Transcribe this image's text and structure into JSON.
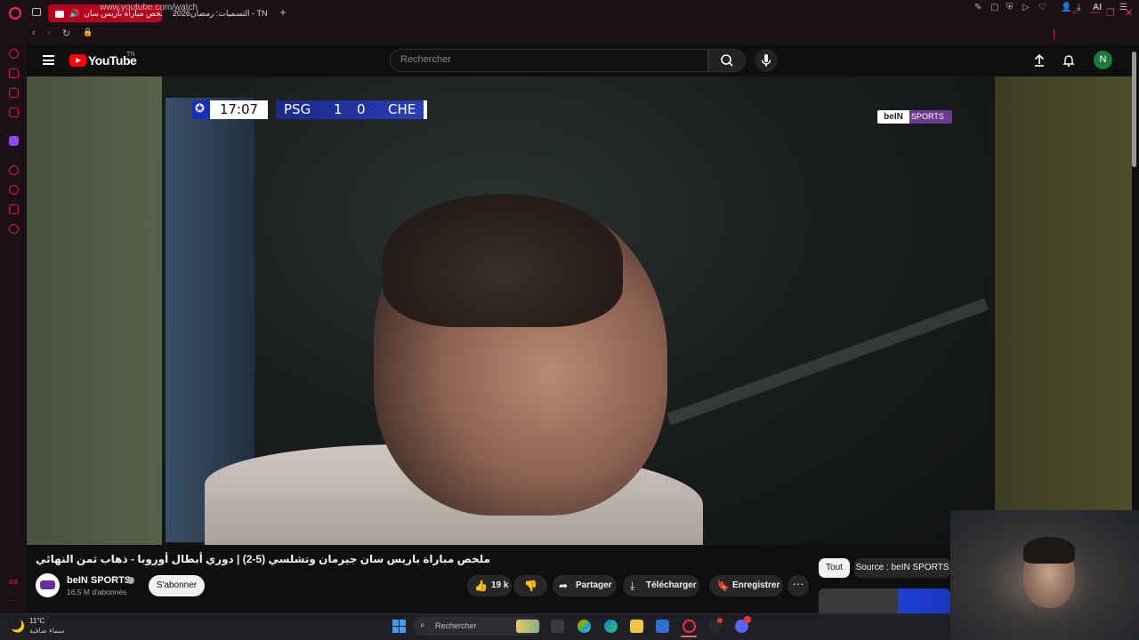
{
  "browser": {
    "tabs": [
      {
        "label": "ملخص مباراة باريس سان",
        "active": true
      },
      {
        "label": "التسميات: رمضان2026 - TN",
        "active": false
      }
    ],
    "url": "www.youtube.com/watch",
    "ai_label": "AI"
  },
  "youtube": {
    "logo_text": "YouTube",
    "country_code": "TN",
    "search_placeholder": "Rechercher",
    "avatar_letter": "N"
  },
  "video": {
    "scoreboard": {
      "time": "17:07",
      "home": "PSG",
      "home_score": "1",
      "away_score": "0",
      "away": "CHE"
    },
    "broadcaster_logo": {
      "part1": "beIN",
      "part2": "SPORTS"
    },
    "title": "ملخص مباراة باريس سان جيرمان وتشلسي (5-2) | دوري أبطال أوروبا - ذهاب ثمن النهائي",
    "channel": {
      "name": "beIN SPORTS",
      "subscribers": "16,5 M d'abonnés"
    },
    "subscribe_label": "S'abonner",
    "likes": "19 k",
    "actions": {
      "share": "Partager",
      "download": "Télécharger",
      "save": "Enregistrer"
    }
  },
  "filter_chips": [
    "Tout",
    "Source : beIN SPORTS"
  ],
  "taskbar": {
    "temperature": "11°C",
    "weather_desc": "سماء صافية",
    "search_label": "Rechercher"
  },
  "colors": {
    "opera_red": "#ff2a45",
    "youtube_red": "#ff0000",
    "scoreboard_blue": "#1a2a8a",
    "bein_purple": "#6a3b8f"
  }
}
